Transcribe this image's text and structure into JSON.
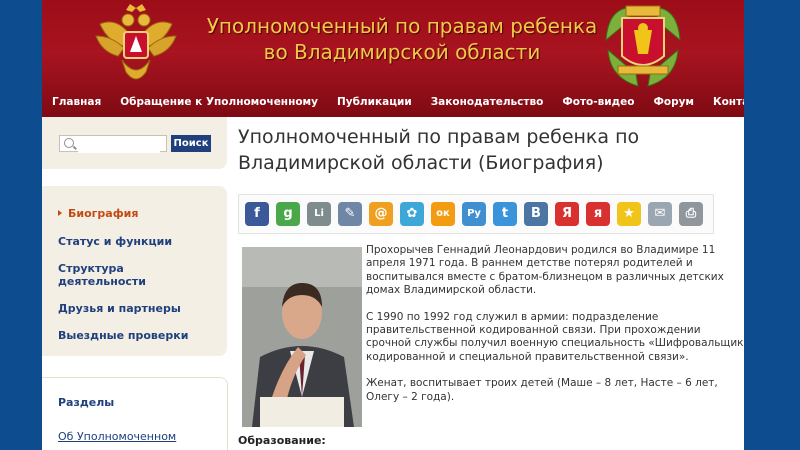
{
  "header": {
    "title_line1": "Уполномоченный по правам ребенка",
    "title_line2": "во Владимирской области"
  },
  "nav": [
    {
      "label": "Главная"
    },
    {
      "label": "Обращение к Уполномоченному"
    },
    {
      "label": "Публикации"
    },
    {
      "label": "Законодательство"
    },
    {
      "label": "Фото-видео"
    },
    {
      "label": "Форум"
    },
    {
      "label": "Контакты"
    }
  ],
  "search": {
    "placeholder": "",
    "button_label": "Поиск"
  },
  "sidebar": {
    "items": [
      {
        "label": "Биография"
      },
      {
        "label": "Статус и функции"
      },
      {
        "label": "Структура деятельности"
      },
      {
        "label": "Друзья и партнеры"
      },
      {
        "label": "Выездные проверки"
      }
    ],
    "sections_title": "Разделы",
    "sections_link": "Об Уполномоченном"
  },
  "main": {
    "heading": "Уполномоченный по правам ребенка по Владимирской области (Биография)",
    "share_icons": [
      {
        "name": "facebook-icon",
        "glyph": "f",
        "color": "#3b5998"
      },
      {
        "name": "google-icon",
        "glyph": "g",
        "color": "#4aa84a"
      },
      {
        "name": "liveinternet-icon",
        "glyph": "Li",
        "color": "#7f8c8d"
      },
      {
        "name": "bookmark-icon",
        "glyph": "✎",
        "color": "#6f86a6"
      },
      {
        "name": "mailru-icon",
        "glyph": "@",
        "color": "#f0a020"
      },
      {
        "name": "moikrug-icon",
        "glyph": "✿",
        "color": "#3da7d8"
      },
      {
        "name": "odnoklassniki-icon",
        "glyph": "ок",
        "color": "#f39c12"
      },
      {
        "name": "ru-icon",
        "glyph": "Ру",
        "color": "#3f8fd1"
      },
      {
        "name": "twitter-icon",
        "glyph": "t",
        "color": "#3b94d9"
      },
      {
        "name": "vkontakte-icon",
        "glyph": "В",
        "color": "#4c75a3"
      },
      {
        "name": "yandex-icon",
        "glyph": "Я",
        "color": "#d93030"
      },
      {
        "name": "yaru-icon",
        "glyph": "я",
        "color": "#d93030"
      },
      {
        "name": "favorites-icon",
        "glyph": "★",
        "color": "#f0c419"
      },
      {
        "name": "email-icon",
        "glyph": "✉",
        "color": "#9aa7b3"
      },
      {
        "name": "print-icon",
        "glyph": "⎙",
        "color": "#8f969c"
      }
    ],
    "bio_paragraphs": [
      "Прохорычев Геннадий Леонардович родился  во Владимире 11 апреля 1971 года. В раннем детстве потерял родителей и воспитывался вместе с братом-близнецом в различных детских домах Владимирской области.",
      "С 1990 по 1992 год служил в армии: подразделение правительственной кодированной связи. При прохождении срочной службы получил  военную специальность «Шифровальщик кодированной и специальной правительственной связи».",
      "Женат, воспитывает троих детей (Маше – 8 лет, Насте – 6 лет, Олегу – 2 года)."
    ],
    "education_label": "Образование:"
  }
}
